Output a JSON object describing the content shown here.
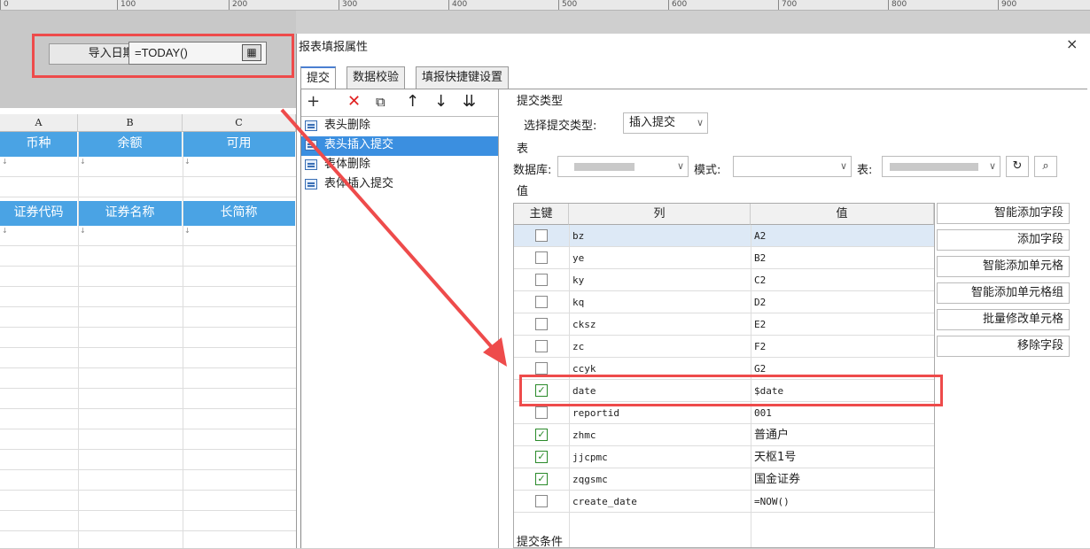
{
  "ruler": {
    "ticks": [
      "0",
      "100",
      "200",
      "300",
      "400",
      "500",
      "600",
      "700",
      "800",
      "900"
    ]
  },
  "param": {
    "label": "导入日期:",
    "value": "=TODAY()"
  },
  "sheet": {
    "columns": [
      "A",
      "B",
      "C"
    ],
    "row1": [
      "币种",
      "余额",
      "可用"
    ],
    "row2": [
      "证券代码",
      "证券名称",
      "长简称"
    ]
  },
  "dialog": {
    "title": "报表填报属性",
    "close": "×",
    "tabs": [
      "提交",
      "数据校验",
      "填报快捷键设置"
    ],
    "toolbar": {
      "add": "+",
      "delete": "✕",
      "copy": "⧉",
      "up": "↑",
      "down": "↓",
      "sort": "⇊"
    },
    "list": [
      "表头删除",
      "表头插入提交",
      "表体删除",
      "表体插入提交"
    ],
    "submit_type_section": "提交类型",
    "select_type_label": "选择提交类型:",
    "select_type_value": "插入提交",
    "table_section": "表",
    "db_label": "数据库:",
    "schema_label": "模式:",
    "table_label": "表:",
    "value_section": "值",
    "grid_headers": [
      "主键",
      "列",
      "值"
    ],
    "rows": [
      {
        "col": "bz",
        "val": "A2",
        "checked": ""
      },
      {
        "col": "ye",
        "val": "B2",
        "checked": ""
      },
      {
        "col": "ky",
        "val": "C2",
        "checked": ""
      },
      {
        "col": "kq",
        "val": "D2",
        "checked": ""
      },
      {
        "col": "cksz",
        "val": "E2",
        "checked": ""
      },
      {
        "col": "zc",
        "val": "F2",
        "checked": ""
      },
      {
        "col": "ccyk",
        "val": "G2",
        "checked": ""
      },
      {
        "col": "date",
        "val": "$date",
        "checked": "✓"
      },
      {
        "col": "reportid",
        "val": "001",
        "checked": ""
      },
      {
        "col": "zhmc",
        "val": "普通户",
        "checked": "✓"
      },
      {
        "col": "jjcpmc",
        "val": "天枢1号",
        "checked": "✓"
      },
      {
        "col": "zqgsmc",
        "val": "国金证券",
        "checked": "✓"
      },
      {
        "col": "create_date",
        "val": "=NOW()",
        "checked": ""
      }
    ],
    "side_buttons": [
      "智能添加字段",
      "添加字段",
      "智能添加单元格",
      "智能添加单元格组",
      "批量修改单元格",
      "移除字段"
    ],
    "submit_condition": "提交条件"
  },
  "colors": {
    "highlight": "#ee4b4b",
    "header_blue": "#4aa3e4",
    "selection": "#3b8fe0"
  }
}
